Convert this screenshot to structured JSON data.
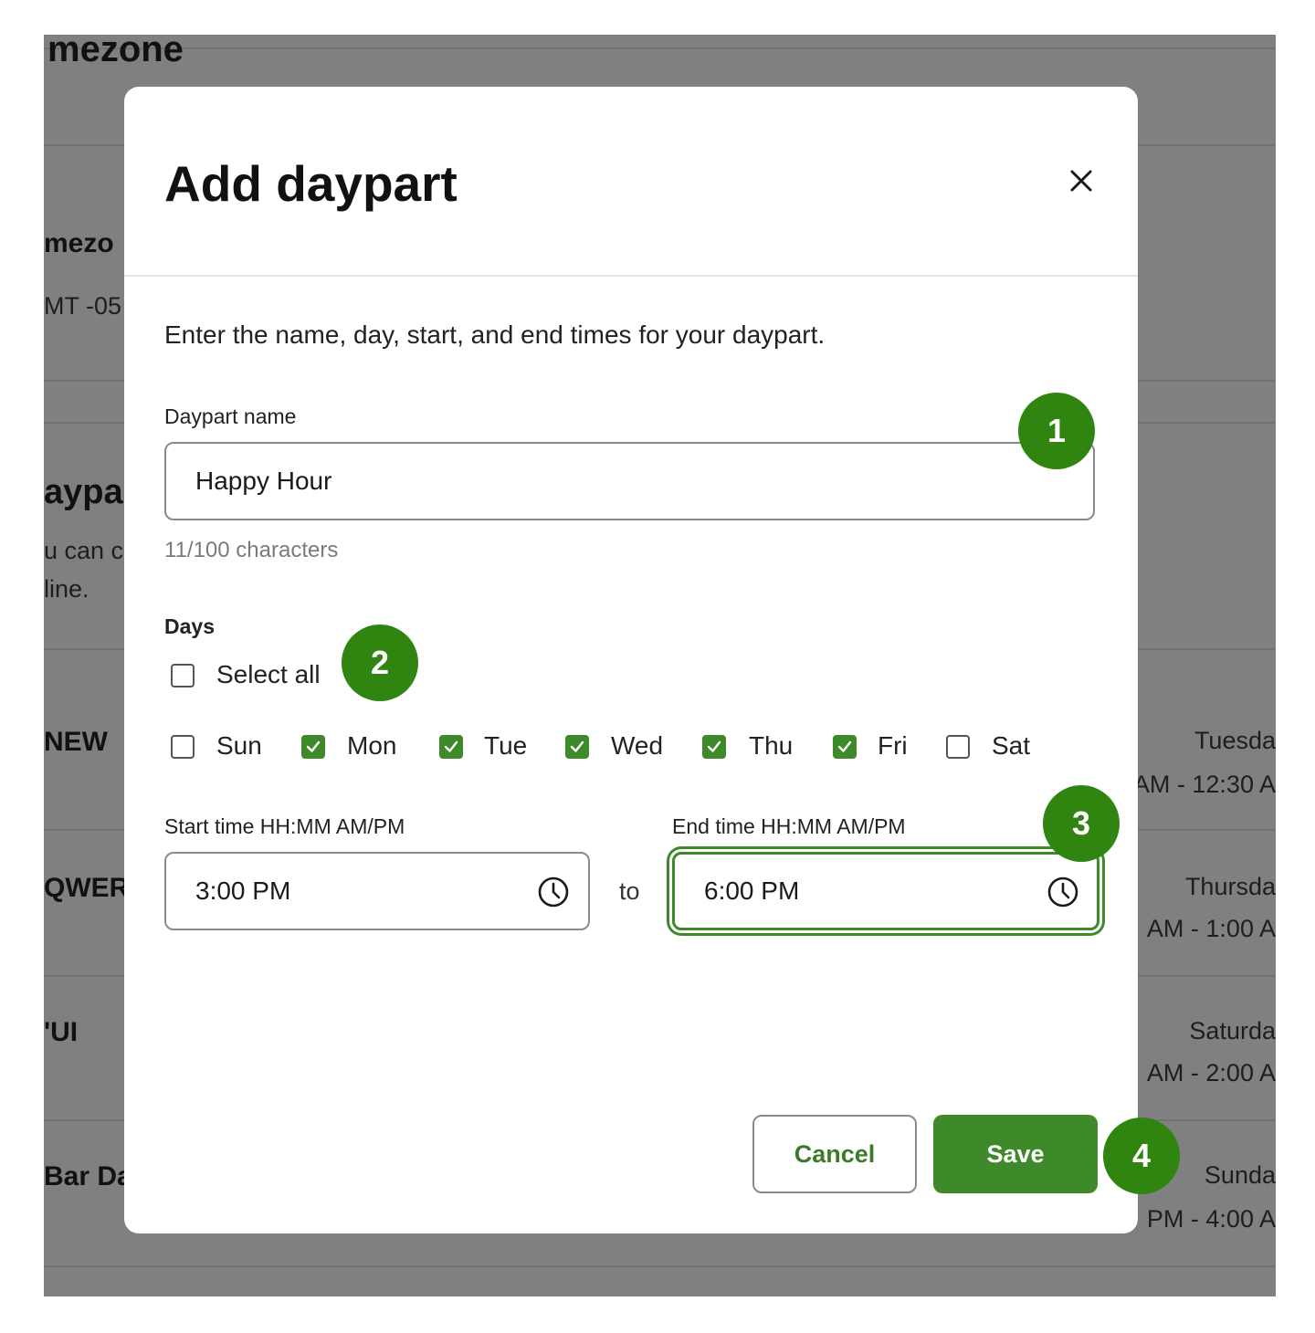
{
  "background": {
    "header_fragment": "mezone",
    "timezone_label": "mezo",
    "timezone_value": "MT -05",
    "section_title": "aypa",
    "section_desc_line1": "u can c",
    "section_desc_line2": "line.",
    "rows": [
      {
        "name": "NEW",
        "day": "Tuesda",
        "time": "AM - 12:30 A"
      },
      {
        "name": "QWERT",
        "day": "Thursda",
        "time": "AM - 1:00 A"
      },
      {
        "name": "'UI",
        "day": "Saturda",
        "time": "AM - 2:00 A"
      },
      {
        "name": "Bar Da",
        "day": "Sunda",
        "time": "PM - 4:00 A"
      }
    ]
  },
  "modal": {
    "title": "Add daypart",
    "intro": "Enter the name, day, start, and end times for your daypart.",
    "name_label": "Daypart name",
    "name_value": "Happy Hour",
    "char_count": "11/100 characters",
    "days_label": "Days",
    "select_all_label": "Select all",
    "select_all_checked": false,
    "days": [
      {
        "label": "Sun",
        "checked": false
      },
      {
        "label": "Mon",
        "checked": true
      },
      {
        "label": "Tue",
        "checked": true
      },
      {
        "label": "Wed",
        "checked": true
      },
      {
        "label": "Thu",
        "checked": true
      },
      {
        "label": "Fri",
        "checked": true
      },
      {
        "label": "Sat",
        "checked": false
      }
    ],
    "start_label": "Start time HH:MM AM/PM",
    "start_value": "3:00 PM",
    "to_label": "to",
    "end_label": "End time HH:MM AM/PM",
    "end_value": "6:00 PM",
    "cancel_label": "Cancel",
    "save_label": "Save"
  },
  "badges": [
    "1",
    "2",
    "3",
    "4"
  ],
  "colors": {
    "accent": "#3e8a2b",
    "badge": "#2f850f",
    "overlay": "#808080"
  }
}
